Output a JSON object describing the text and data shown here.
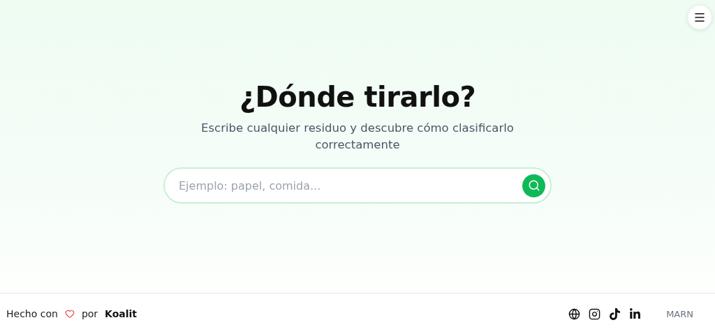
{
  "hero": {
    "title": "¿Dónde tirarlo?",
    "subtitle": "Escribe cualquier residuo y descubre cómo clasificarlo correctamente"
  },
  "search": {
    "placeholder": "Ejemplo: papel, comida..."
  },
  "footer": {
    "made_with": "Hecho con",
    "by": "por",
    "author": "Koalit",
    "social": [
      {
        "kind": "web"
      },
      {
        "kind": "instagram"
      },
      {
        "kind": "tiktok"
      },
      {
        "kind": "linkedin"
      }
    ],
    "partner": "MARN"
  }
}
